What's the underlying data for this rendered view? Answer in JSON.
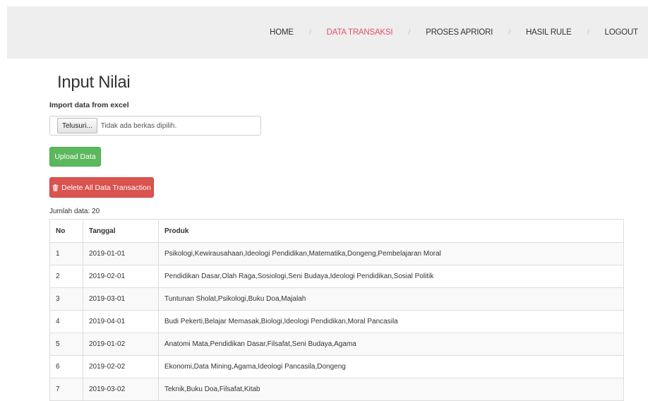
{
  "nav": {
    "items": [
      {
        "label": "HOME",
        "active": false
      },
      {
        "label": "DATA TRANSAKSI",
        "active": true
      },
      {
        "label": "PROSES APRIORI",
        "active": false
      },
      {
        "label": "HASIL RULE",
        "active": false
      },
      {
        "label": "LOGOUT",
        "active": false
      }
    ],
    "separator": "/",
    "active_color": "#e0506a"
  },
  "page": {
    "title": "Input Nilai",
    "import_label": "Import data from excel"
  },
  "file_input": {
    "browse_label": "Telusuri...",
    "status": "Tidak ada berkas dipilih."
  },
  "buttons": {
    "upload": "Upload Data",
    "delete_all": "Delete All Data Transaction",
    "upload_color": "#5cb85c",
    "delete_color": "#d9534f",
    "delete_icon": "trash-icon"
  },
  "count_text": "Jumlah data: 20",
  "table": {
    "headers": [
      "No",
      "Tanggal",
      "Produk"
    ],
    "rows": [
      [
        "1",
        "2019-01-01",
        "Psikologi,Kewirausahaan,Ideologi Pendidikan,Matematika,Dongeng,Pembelajaran Moral"
      ],
      [
        "2",
        "2019-02-01",
        "Pendidikan Dasar,Olah Raga,Sosiologi,Seni Budaya,Ideologi Pendidikan,Sosial Politik"
      ],
      [
        "3",
        "2019-03-01",
        "Tuntunan Sholat,Psikologi,Buku Doa,Majalah"
      ],
      [
        "4",
        "2019-04-01",
        "Budi Pekerti,Belajar Memasak,Biologi,Ideologi Pendidikan,Moral Pancasila"
      ],
      [
        "5",
        "2019-01-02",
        "Anatomi Mata,Pendidikan Dasar,Filsafat,Seni Budaya,Agama"
      ],
      [
        "6",
        "2019-02-02",
        "Ekonomi,Data Mining,Agama,Ideologi Pancasila,Dongeng"
      ],
      [
        "7",
        "2019-03-02",
        "Teknik,Buku Doa,Filsafat,Kitab"
      ]
    ]
  }
}
